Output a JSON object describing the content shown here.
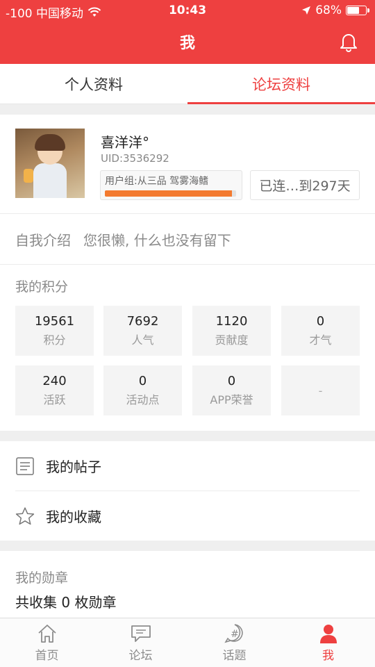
{
  "status_bar": {
    "carrier": "-100 中国移动",
    "time": "10:43",
    "battery_text": "68%",
    "battery_level": 0.68
  },
  "nav": {
    "title": "我"
  },
  "tabs": [
    {
      "label": "个人资料",
      "active": false
    },
    {
      "label": "论坛资料",
      "active": true
    }
  ],
  "profile": {
    "name": "喜洋洋°",
    "uid": "UID:3536292",
    "group_text": "用户组:从三品  驾雾海鳍",
    "group_progress": 0.97,
    "sign_text": "已连…到297天"
  },
  "intro": {
    "label": "自我介绍",
    "text": "您很懒, 什么也没有留下"
  },
  "points": {
    "title": "我的积分",
    "items": [
      {
        "value": "19561",
        "label": "积分"
      },
      {
        "value": "7692",
        "label": "人气"
      },
      {
        "value": "1120",
        "label": "贡献度"
      },
      {
        "value": "0",
        "label": "才气"
      },
      {
        "value": "240",
        "label": "活跃"
      },
      {
        "value": "0",
        "label": "活动点"
      },
      {
        "value": "0",
        "label": "APP荣誉"
      },
      {
        "value": "-",
        "label": ""
      }
    ]
  },
  "menu": {
    "posts": "我的帖子",
    "favorites": "我的收藏"
  },
  "medals": {
    "title": "我的勋章",
    "count_text": "共收集 0 枚勋章"
  },
  "tabbar": [
    {
      "label": "首页",
      "icon": "home-icon",
      "active": false
    },
    {
      "label": "论坛",
      "icon": "forum-icon",
      "active": false
    },
    {
      "label": "话题",
      "icon": "topic-icon",
      "active": false
    },
    {
      "label": "我",
      "icon": "user-icon",
      "active": true
    }
  ],
  "colors": {
    "accent": "#ee4040",
    "progress": "#f37a2f"
  }
}
